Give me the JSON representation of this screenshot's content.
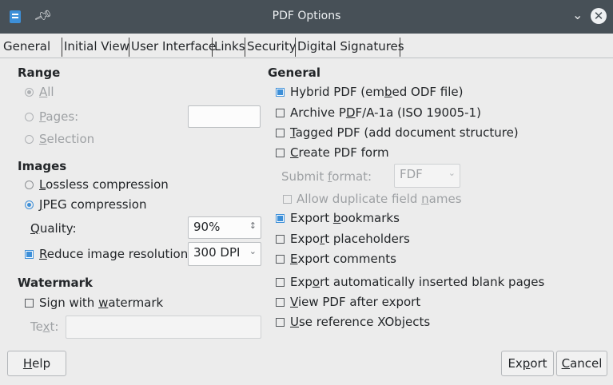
{
  "window": {
    "title": "PDF Options"
  },
  "tabs": [
    "General",
    "Initial View",
    "User Interface",
    "Links",
    "Security",
    "Digital Signatures"
  ],
  "range": {
    "header": "Range",
    "all": {
      "pre": "",
      "u": "A",
      "post": "ll"
    },
    "pages": {
      "pre": "",
      "u": "P",
      "post": "ages:"
    },
    "selection": {
      "pre": "",
      "u": "S",
      "post": "election"
    }
  },
  "images": {
    "header": "Images",
    "lossless": {
      "pre": "",
      "u": "L",
      "post": "ossless compression"
    },
    "jpeg": {
      "pre": "",
      "u": "J",
      "post": "PEG compression"
    },
    "quality_label": {
      "pre": "",
      "u": "Q",
      "post": "uality:"
    },
    "quality_value": "90%",
    "reduce": {
      "pre": "",
      "u": "R",
      "post": "educe image resolution"
    },
    "resolution_value": "300 DPI"
  },
  "watermark": {
    "header": "Watermark",
    "sign": {
      "pre": "Sign with ",
      "u": "w",
      "post": "atermark"
    },
    "text_label": {
      "pre": "Te",
      "u": "x",
      "post": "t:"
    }
  },
  "general": {
    "header": "General",
    "hybrid": {
      "pre": "Hybrid PDF (em",
      "u": "b",
      "post": "ed ODF file)"
    },
    "archive": {
      "pre": "Archive P",
      "u": "D",
      "post": "F/A-1a (ISO 19005-1)"
    },
    "tagged": {
      "pre": "",
      "u": "T",
      "post": "agged PDF (add document structure)"
    },
    "form": {
      "pre": "",
      "u": "C",
      "post": "reate PDF form"
    },
    "submit_label": {
      "pre": "Submit ",
      "u": "f",
      "post": "ormat:"
    },
    "submit_value": "FDF",
    "allow_dup": {
      "pre": "Allow duplicate field ",
      "u": "n",
      "post": "ames"
    },
    "bookmarks": {
      "pre": "Export ",
      "u": "b",
      "post": "ookmarks"
    },
    "placeholders": {
      "pre": "Expo",
      "u": "r",
      "post": "t placeholders"
    },
    "comments": {
      "pre": "",
      "u": "E",
      "post": "xport comments"
    },
    "blank_pages": {
      "pre": "Exp",
      "u": "o",
      "post": "rt automatically inserted blank pages"
    },
    "view_after": {
      "pre": "",
      "u": "V",
      "post": "iew PDF after export"
    },
    "xobjects": {
      "pre": "",
      "u": "U",
      "post": "se reference XObjects"
    }
  },
  "buttons": {
    "help": {
      "pre": "",
      "u": "H",
      "post": "elp"
    },
    "export": {
      "pre": "Ex",
      "u": "p",
      "post": "ort"
    },
    "cancel": {
      "pre": "",
      "u": "C",
      "post": "ancel"
    }
  }
}
